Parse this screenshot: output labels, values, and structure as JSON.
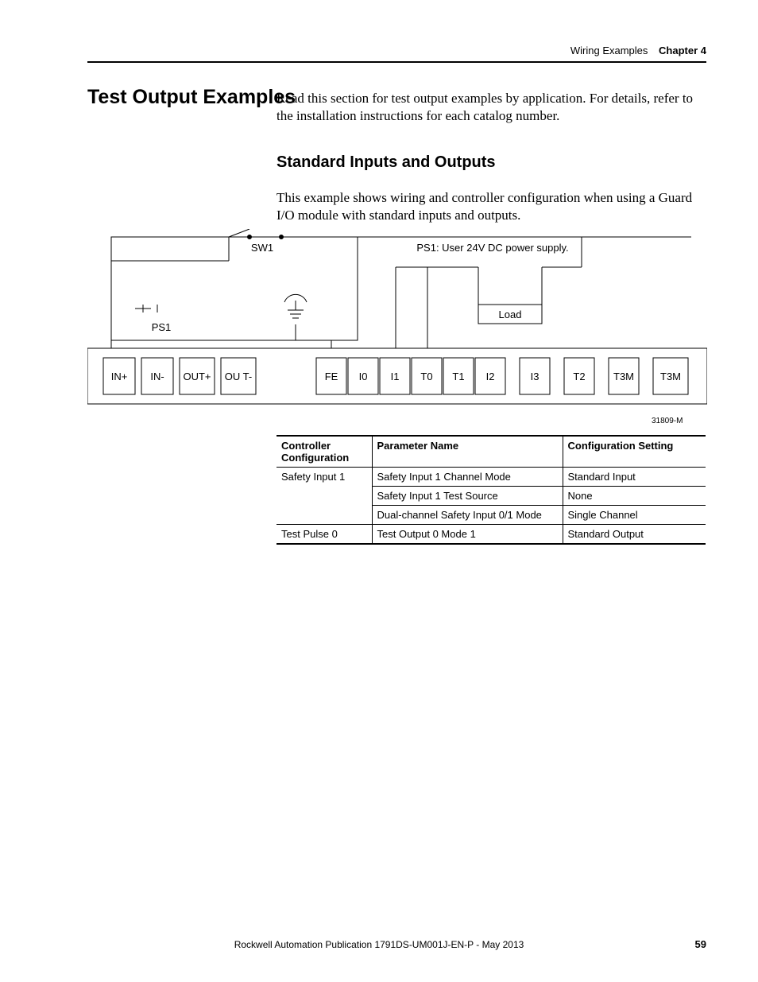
{
  "header": {
    "running_title": "Wiring Examples",
    "chapter": "Chapter 4"
  },
  "heading": "Test Output Examples",
  "intro": "Read this section for test output examples by application. For details, refer to the installation instructions for each catalog number.",
  "sub_heading": "Standard Inputs and Outputs",
  "sub_text": "This example shows wiring and controller configuration when using a Guard I/O module with standard inputs and outputs.",
  "diagram": {
    "sw1": "SW1",
    "ps1_note": "PS1: User 24V DC power supply.",
    "ps1": "PS1",
    "load": "Load",
    "terminals": [
      "IN+",
      "IN-",
      "OUT+",
      "OU T-",
      "FE",
      "I0",
      "I1",
      "T0",
      "T1",
      "I2",
      "I3",
      "T2",
      "T3M"
    ],
    "fig_id": "31809-M"
  },
  "table": {
    "headers": [
      "Controller Configuration",
      "Parameter Name",
      "Configuration Setting"
    ],
    "rows": [
      {
        "cc": "Safety Input 1",
        "pn": "Safety Input 1 Channel Mode",
        "cs": "Standard Input",
        "rowspan": 3
      },
      {
        "cc": "",
        "pn": "Safety Input 1 Test Source",
        "cs": "None"
      },
      {
        "cc": "",
        "pn": "Dual-channel Safety Input 0/1 Mode",
        "cs": "Single Channel"
      },
      {
        "cc": "Test Pulse 0",
        "pn": "Test Output 0 Mode 1",
        "cs": "Standard Output",
        "rowspan": 1
      }
    ]
  },
  "footer": "Rockwell Automation Publication 1791DS-UM001J-EN-P - May 2013",
  "page_num": "59"
}
